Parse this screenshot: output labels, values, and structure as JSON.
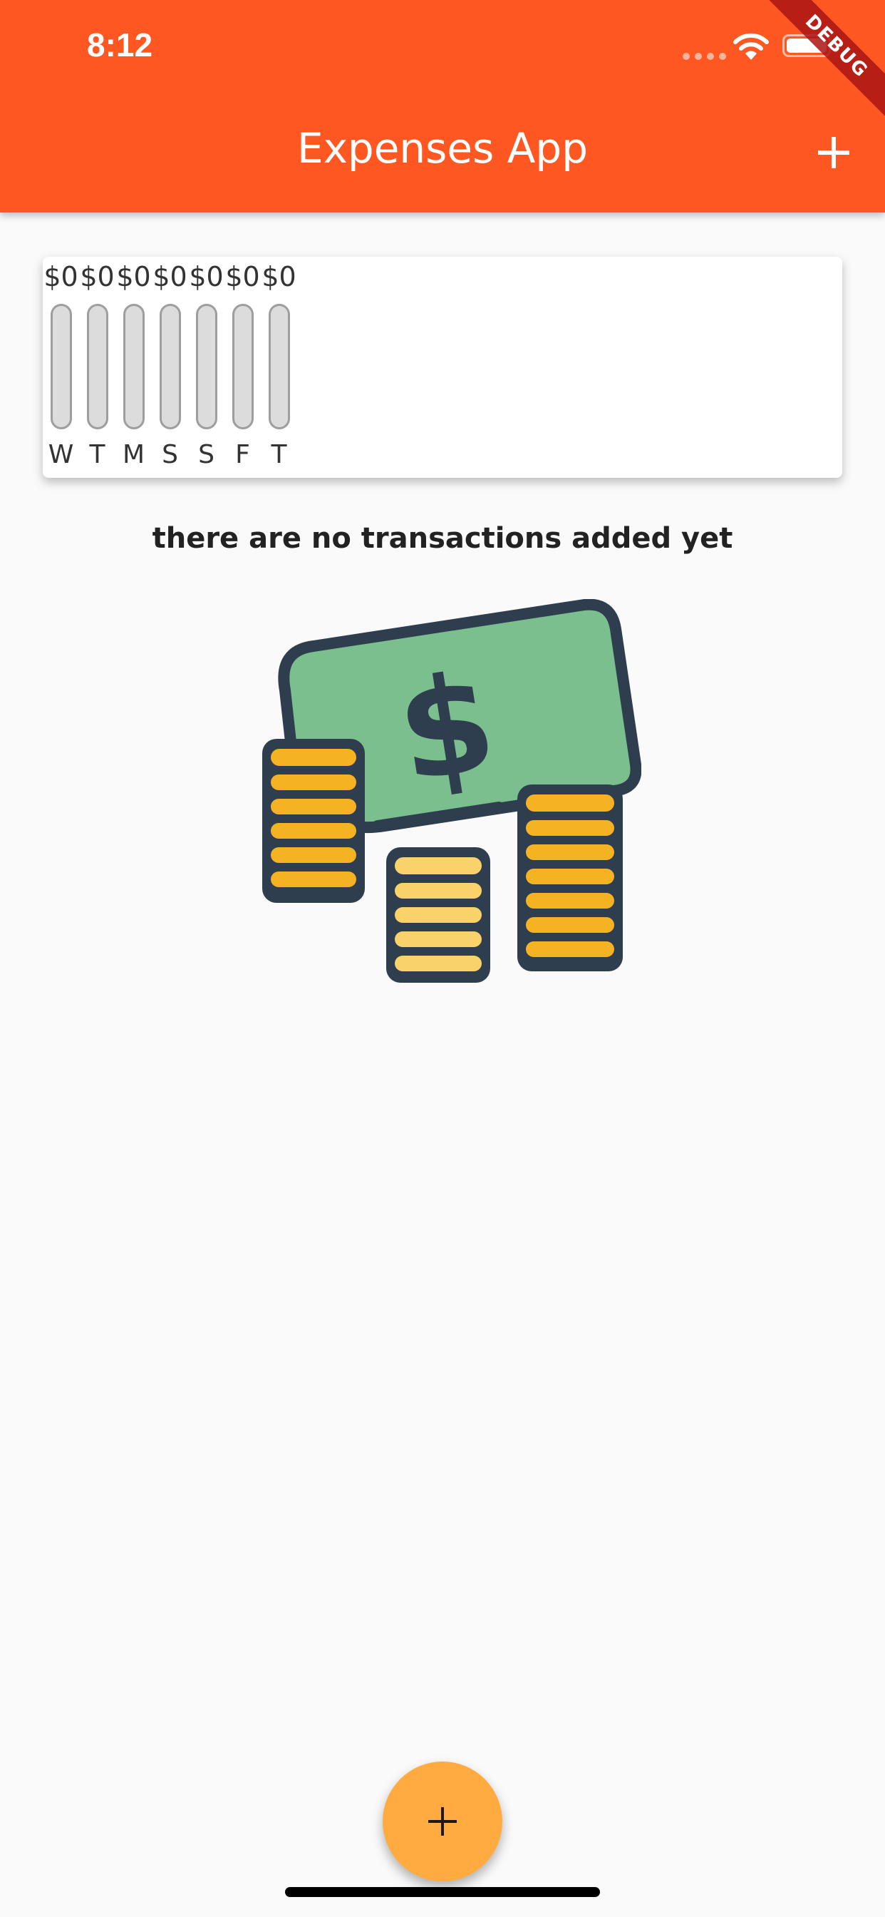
{
  "status_bar": {
    "time": "8:12"
  },
  "debug_banner": "DEBUG",
  "app_bar": {
    "title": "Expenses App",
    "add_icon": "plus-icon"
  },
  "chart": {
    "bars": [
      {
        "day": "W",
        "amount": "$0",
        "fraction": 0
      },
      {
        "day": "T",
        "amount": "$0",
        "fraction": 0
      },
      {
        "day": "M",
        "amount": "$0",
        "fraction": 0
      },
      {
        "day": "S",
        "amount": "$0",
        "fraction": 0
      },
      {
        "day": "S",
        "amount": "$0",
        "fraction": 0
      },
      {
        "day": "F",
        "amount": "$0",
        "fraction": 0
      },
      {
        "day": "T",
        "amount": "$0",
        "fraction": 0
      }
    ]
  },
  "empty_state": {
    "message": "there are no transactions added yet",
    "illustration": "money-coins-illustration"
  },
  "fab": {
    "icon": "plus-icon"
  },
  "colors": {
    "primary": "#ff5722",
    "accent": "#ffab40",
    "background": "#fafafa"
  }
}
